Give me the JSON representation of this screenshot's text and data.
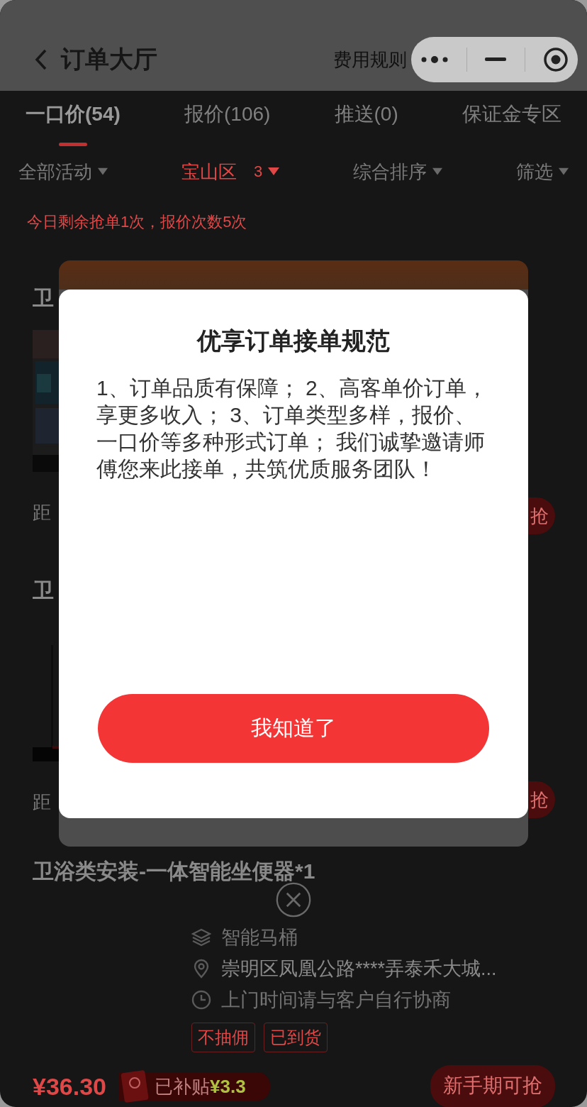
{
  "nav": {
    "title": "订单大厅",
    "link": "费用规则"
  },
  "tabs": [
    {
      "label": "一口价(54)",
      "selected": true
    },
    {
      "label": "报价(106)",
      "selected": false
    },
    {
      "label": "推送(0)",
      "selected": false
    },
    {
      "label": "保证金专区",
      "selected": false
    }
  ],
  "filters": [
    {
      "label": "全部活动",
      "selected": false
    },
    {
      "label": "宝山区",
      "selected": true,
      "count": "3"
    },
    {
      "label": "综合排序",
      "selected": false
    },
    {
      "label": "筛选",
      "selected": false
    }
  ],
  "notice": "今日剩余抢单1次，报价次数5次",
  "orders": [
    {
      "kind": "partial",
      "title": "卫",
      "distance": "距",
      "action": "抢"
    },
    {
      "kind": "partial",
      "title": "卫",
      "distance": "距",
      "action": "抢"
    },
    {
      "kind": "full",
      "title": "卫浴类安装-一体智能坐便器*1",
      "category": "智能马桶",
      "address": "崇明区凤凰公路****弄泰禾大城...",
      "time": "上门时间请与客户自行协商",
      "tags": [
        "不抽佣",
        "已到货"
      ],
      "price": "¥36.30",
      "subsidy_label": "已补贴",
      "subsidy_amount": "¥3.3",
      "action": "新手期可抢"
    }
  ],
  "dialog": {
    "title": "优享订单接单规范",
    "body": "1、订单品质有保障； 2、高客单价订单，享更多收入； 3、订单类型多样，报价、一口价等多种形式订单； 我们诚挚邀请师傅您来此接单，共筑优质服务团队！",
    "button": "我知道了"
  }
}
